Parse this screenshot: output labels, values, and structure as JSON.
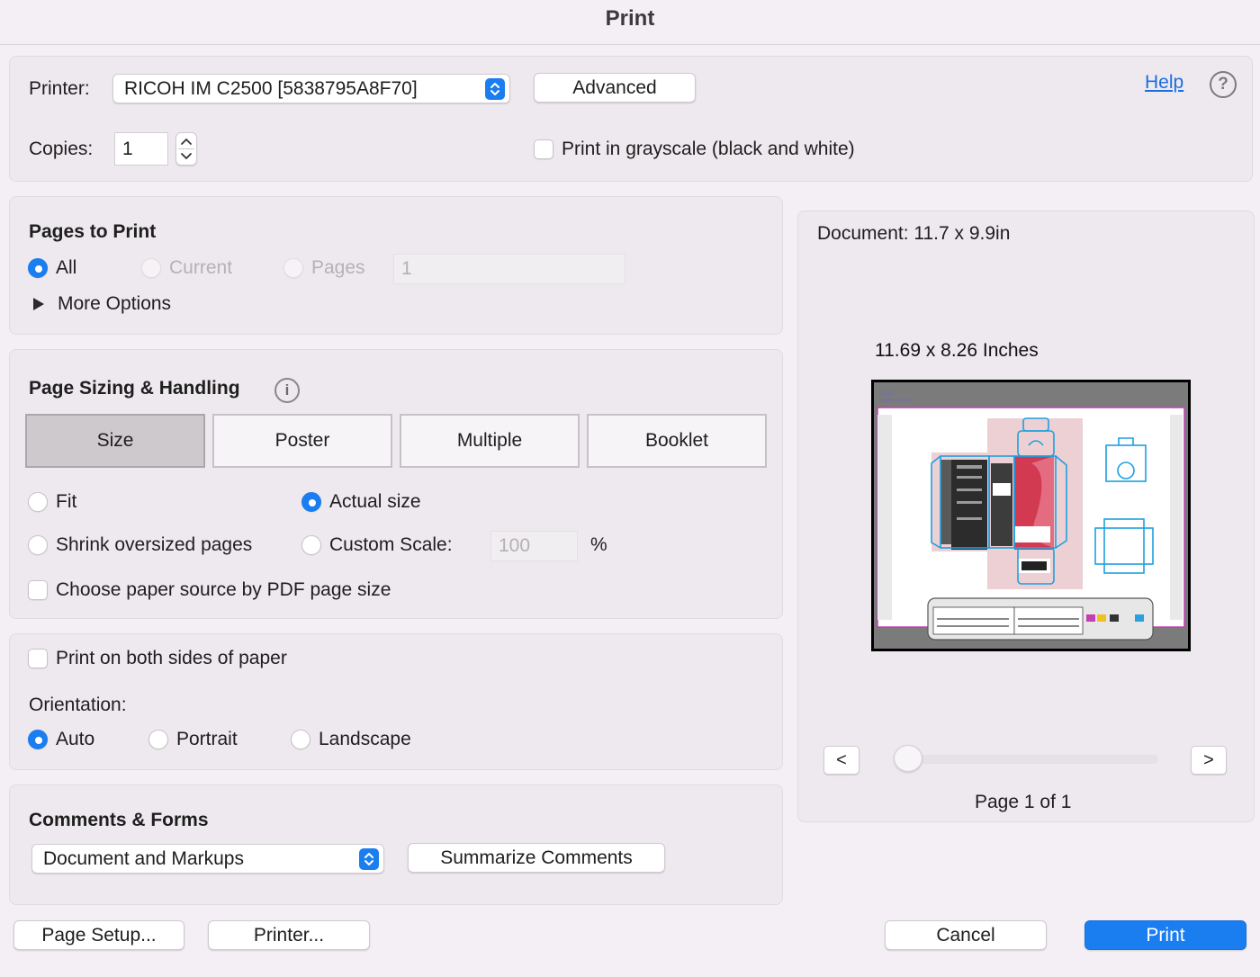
{
  "window": {
    "title": "Print"
  },
  "printer": {
    "label": "Printer:",
    "value": "RICOH IM C2500 [5838795A8F70]",
    "advanced_label": "Advanced",
    "help_label": "Help"
  },
  "copies": {
    "label": "Copies:",
    "value": "1"
  },
  "grayscale": {
    "label": "Print in grayscale (black and white)",
    "checked": false
  },
  "pages_to_print": {
    "heading": "Pages to Print",
    "options": [
      {
        "label": "All",
        "selected": true,
        "enabled": true
      },
      {
        "label": "Current",
        "selected": false,
        "enabled": false
      },
      {
        "label": "Pages",
        "selected": false,
        "enabled": false
      }
    ],
    "pages_value": "1",
    "more_options_label": "More Options"
  },
  "page_sizing": {
    "heading": "Page Sizing & Handling",
    "tabs": [
      "Size",
      "Poster",
      "Multiple",
      "Booklet"
    ],
    "active_tab": "Size",
    "fit_label": "Fit",
    "actual_size_label": "Actual size",
    "shrink_label": "Shrink oversized pages",
    "custom_scale_label": "Custom Scale:",
    "custom_scale_value": "100",
    "percent_label": "%",
    "paper_source_label": "Choose paper source by PDF page size"
  },
  "duplex": {
    "label": "Print on both sides of paper",
    "checked": false
  },
  "orientation": {
    "label": "Orientation:",
    "options": [
      {
        "label": "Auto",
        "selected": true
      },
      {
        "label": "Portrait",
        "selected": false
      },
      {
        "label": "Landscape",
        "selected": false
      }
    ]
  },
  "comments_forms": {
    "heading": "Comments & Forms",
    "value": "Document and Markups",
    "summarize_label": "Summarize Comments"
  },
  "preview": {
    "document_size": "Document: 11.7 x 9.9in",
    "paper_size": "11.69 x 8.26 Inches",
    "prev_label": "<",
    "next_label": ">",
    "page_status": "Page 1 of 1",
    "page_position": 1,
    "page_count": 1
  },
  "footer": {
    "page_setup_label": "Page Setup...",
    "printer_label": "Printer...",
    "cancel_label": "Cancel",
    "print_label": "Print"
  },
  "colors": {
    "accent": "#1a7df0",
    "link": "#1a6fe0",
    "background": "#f4eff4",
    "panel": "#eee9ee"
  }
}
